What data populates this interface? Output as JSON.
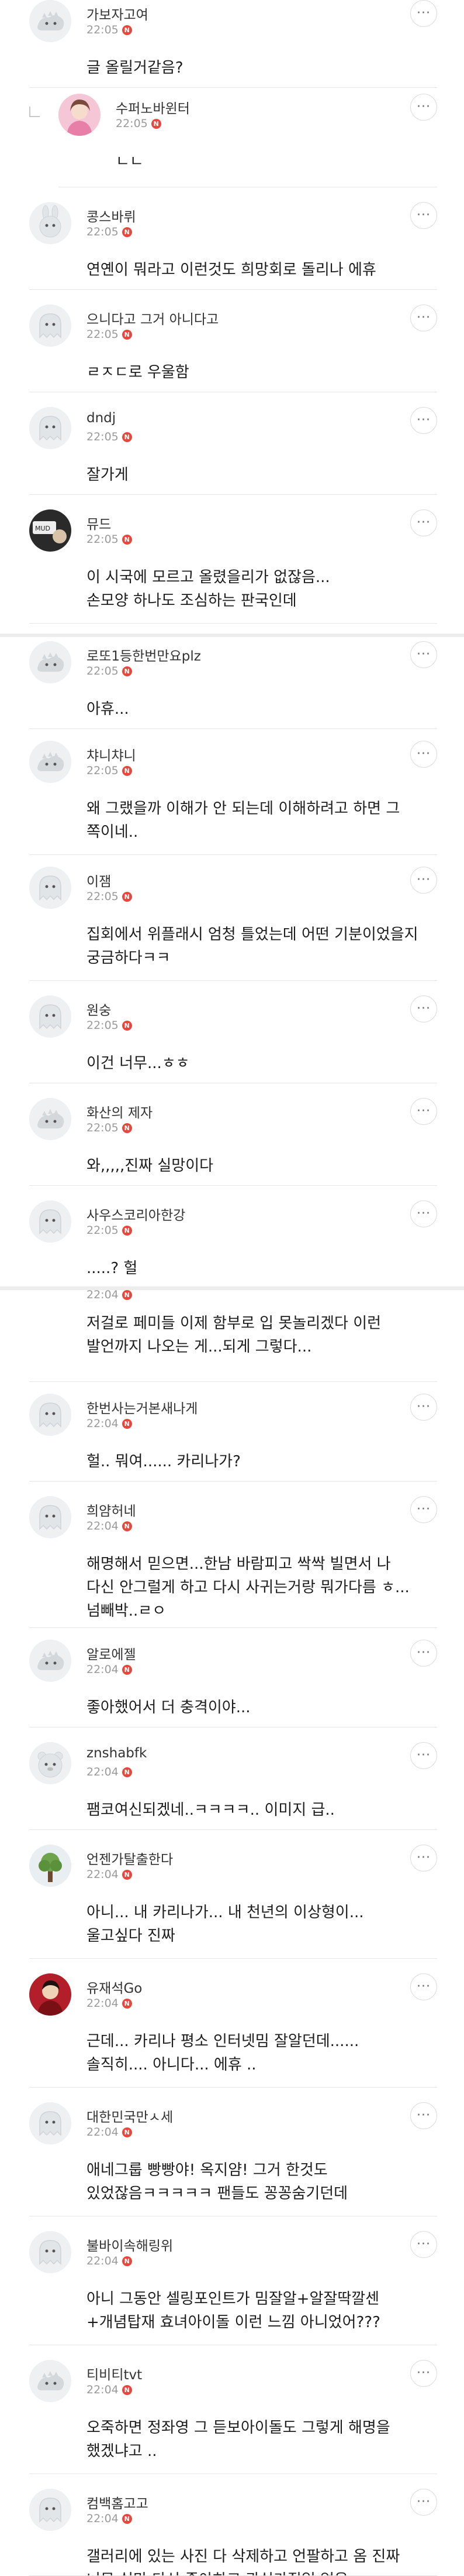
{
  "comments": [
    {
      "nick": "가보자고여",
      "time": "22:05",
      "badge": "N",
      "text": "글 올릴거같음?",
      "avatar": "dino-avatar",
      "reply": false
    },
    {
      "nick": "수퍼노바윈터",
      "time": "22:05",
      "badge": "N",
      "text": "ㄴㄴ",
      "avatar": "photo-avatar-pink",
      "reply": true
    },
    {
      "nick": "콩스바뤼",
      "time": "22:05",
      "badge": "N",
      "text": "연옌이 뭐라고 이런것도 희망회로 돌리나 에휴",
      "avatar": "rabbit-avatar",
      "reply": false
    },
    {
      "nick": "으니다고 그거 아니다고",
      "time": "22:05",
      "badge": "N",
      "text": "ㄹㅈㄷ로 우울함",
      "avatar": "ghost-avatar",
      "reply": false
    },
    {
      "nick": "dndj",
      "time": "22:05",
      "badge": "N",
      "text": "잘가게",
      "avatar": "ghost-avatar",
      "reply": false
    },
    {
      "nick": "뮤드",
      "time": "22:05",
      "badge": "N",
      "text": "이 시국에 모르고 올렸을리가 없잖음...\n손모양 하나도 조심하는 판국인데",
      "avatar": "photo-avatar-dark",
      "reply": false
    },
    {
      "nick": "로또1등한번만요plz",
      "time": "22:05",
      "badge": "N",
      "text": "아휴...",
      "avatar": "dino-avatar",
      "reply": false
    },
    {
      "nick": "챠니챠니",
      "time": "22:05",
      "badge": "N",
      "text": "왜 그랬을까 이해가 안 되는데 이해하려고 하면 그 쪽이네..",
      "avatar": "dino-avatar",
      "reply": false
    },
    {
      "nick": "이잼",
      "time": "22:05",
      "badge": "N",
      "text": "집회에서 위플래시 엄청 틀었는데 어떤 기분이었을지 궁금하다ㅋㅋ",
      "avatar": "ghost-avatar",
      "reply": false
    },
    {
      "nick": "원숭",
      "time": "22:05",
      "badge": "N",
      "text": "이건 너무...ㅎㅎ",
      "avatar": "ghost-avatar",
      "reply": false
    },
    {
      "nick": "화산의 제자",
      "time": "22:05",
      "badge": "N",
      "text": "와,,,,,진짜 실망이다",
      "avatar": "dino-avatar",
      "reply": false
    },
    {
      "nick": "사우스코리아한강",
      "time": "22:05",
      "badge": "N",
      "text": ".....? 헐",
      "avatar": "ghost-avatar",
      "reply": false
    },
    {
      "nick": "",
      "time": "22:04",
      "badge": "N",
      "text": "저걸로 페미들 이제 함부로 입 못놀리겠다 이런 발언까지 나오는 게...되게 그렇다...",
      "avatar": "",
      "reply": false
    },
    {
      "nick": "한번사는거본새나게",
      "time": "22:04",
      "badge": "N",
      "text": "헐.. 뭐여...... 카리나가?",
      "avatar": "ghost-avatar",
      "reply": false
    },
    {
      "nick": "희얌허네",
      "time": "22:04",
      "badge": "N",
      "text": "해명해서 믿으면...한남 바람피고 싹싹 빌면서 나 다신 안그럴게 하고 다시  사귀는거랑 뭐가다름 ㅎ...넘빼박..ㄹㅇ",
      "avatar": "ghost-avatar",
      "reply": false
    },
    {
      "nick": "알로에젤",
      "time": "22:04",
      "badge": "N",
      "text": "좋아했어서 더 충격이야...",
      "avatar": "dino-avatar",
      "reply": false
    },
    {
      "nick": "znshabfk",
      "time": "22:04",
      "badge": "N",
      "text": "팸코여신되겠네..ㅋㅋㅋㅋ.. 이미지 급..",
      "avatar": "bear-avatar",
      "reply": false
    },
    {
      "nick": "언젠가탈출한다",
      "time": "22:04",
      "badge": "N",
      "text": "아니... 내 카리나가... 내 천년의 이상형이... 울고싶다 진짜",
      "avatar": "photo-avatar-tree",
      "reply": false
    },
    {
      "nick": "유재석Go",
      "time": "22:04",
      "badge": "N",
      "text": "근데... 카리나 평소 인터넷밈 잘알던데......\n솔직히.... 아니다... 에휴 ..",
      "avatar": "photo-avatar-red",
      "reply": false
    },
    {
      "nick": "대한민국만ㅅ세",
      "time": "22:04",
      "badge": "N",
      "text": "애네그룹 빵빵야! 옥지얌! 그거 한것도 있었잖음ㅋㅋㅋㅋㅋ 팬들도 꽁꽁숨기던데",
      "avatar": "ghost-avatar",
      "reply": false
    },
    {
      "nick": "불바이속해링위",
      "time": "22:04",
      "badge": "N",
      "text": "아니 그동안 셀링포인트가 밈잘알+알잘딱깔센+개념탑재 효녀아이돌 이런 느낌 아니었어???",
      "avatar": "ghost-avatar",
      "reply": false
    },
    {
      "nick": "티비티tvt",
      "time": "22:04",
      "badge": "N",
      "text": "오죽하면 정좌영 그 듣보아이돌도 그렇게 해명을 했겠냐고 ..",
      "avatar": "dino-avatar",
      "reply": false
    },
    {
      "nick": "컴백홈고고",
      "time": "22:04",
      "badge": "N",
      "text": "갤러리에 있는 사진 다 삭제하고 언팔하고 옴 진짜 너무 실망 다신 좋아하고 관심가질일 없음",
      "avatar": "ghost-avatar",
      "reply": false
    }
  ],
  "more_label": "···",
  "icons": {
    "more": "more-horizontal-icon",
    "new": "new-badge-icon"
  },
  "colors": {
    "badge": "#e8473b",
    "text": "#1d1d1d",
    "meta": "#9a9a9a",
    "divider": "#e6e6e6"
  }
}
